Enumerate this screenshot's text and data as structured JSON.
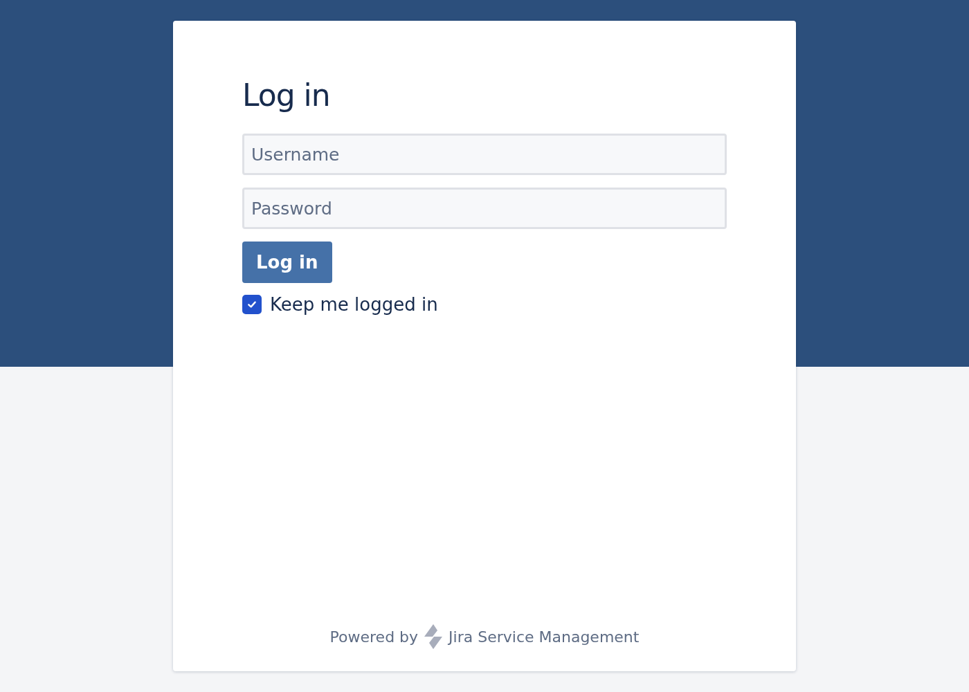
{
  "title": "Log in",
  "fields": [
    {
      "placeholder": "Username"
    },
    {
      "placeholder": "Password"
    }
  ],
  "login_button": "Log in",
  "keep_logged_in": {
    "label": "Keep me logged in",
    "checked": true
  },
  "footer": {
    "prefix": "Powered by",
    "product": "Jira Service Management"
  }
}
